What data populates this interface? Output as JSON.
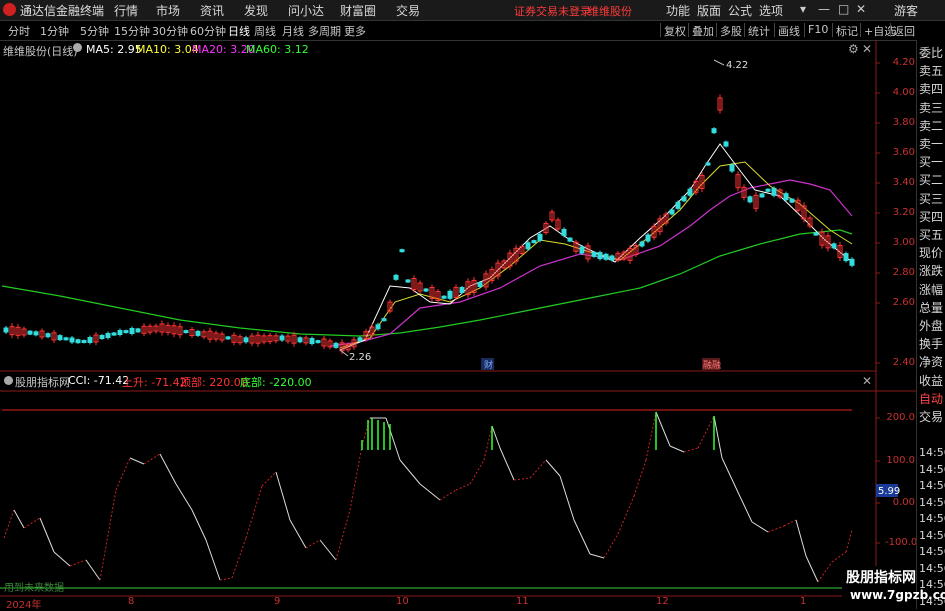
{
  "window": {
    "title": "通达信金融终端",
    "menu": [
      "行情",
      "市场",
      "资讯",
      "发现",
      "问小达",
      "财富圈",
      "交易"
    ],
    "alert": "证券交易未登录",
    "stock_tag": "维维股份",
    "right_menu": [
      "功能",
      "版面",
      "公式",
      "选项"
    ],
    "guest": "游客",
    "win_controls": [
      "▾",
      "—",
      "□",
      "✕"
    ]
  },
  "period_bar": {
    "periods": [
      "分时",
      "1分钟",
      "5分钟",
      "15分钟",
      "30分钟",
      "60分钟",
      "日线",
      "周线",
      "月线",
      "多周期",
      "更多"
    ],
    "active": "日线",
    "tools": [
      "复权",
      "叠加",
      "多股",
      "统计",
      "画线",
      "F10",
      "标记",
      "+自选",
      "返回"
    ]
  },
  "main_chart": {
    "stock_label": "维维股份(日线)",
    "ma": [
      {
        "label": "MA5: 2.95",
        "color": "#ffffff"
      },
      {
        "label": "MA10: 3.04",
        "color": "#ffff33"
      },
      {
        "label": "MA20: 3.20",
        "color": "#ff33ff"
      },
      {
        "label": "MA60: 3.12",
        "color": "#33ff33"
      }
    ],
    "y_labels": [
      "4.20",
      "4.00",
      "3.80",
      "3.60",
      "3.40",
      "3.20",
      "3.00",
      "2.80",
      "2.60",
      "2.40"
    ],
    "high_label": "4.22",
    "low_label": "2.26",
    "markers": [
      "财",
      "融融"
    ]
  },
  "indicator": {
    "name": "股朋指标网",
    "cci": "CCI: -71.42",
    "up": "上升: -71.42",
    "top": "顶部: 220.00",
    "bottom": "底部: -220.00",
    "y_labels": [
      "200.0",
      "100.0",
      "0.00",
      "-100.0"
    ],
    "cursor_value": "5.99"
  },
  "x_axis": [
    "2024年",
    "8",
    "9",
    "10",
    "11",
    "12",
    "1"
  ],
  "right_panel": [
    "委比",
    "卖五",
    "卖四",
    "卖三",
    "卖二",
    "卖一",
    "买一",
    "买二",
    "买三",
    "买四",
    "买五",
    "现价",
    "涨跌",
    "涨幅",
    "总量",
    "外盘",
    "换手",
    "净资",
    "收益",
    "自动",
    "交易",
    "14:56",
    "14:56",
    "14:56",
    "14:56",
    "14:56",
    "14:56",
    "14:56",
    "14:56",
    "14:56",
    "14:56"
  ],
  "footer_hint": "用到未来数据",
  "watermark": {
    "line1": "股朋指标网",
    "line2": "www.7gpzb.com"
  }
}
